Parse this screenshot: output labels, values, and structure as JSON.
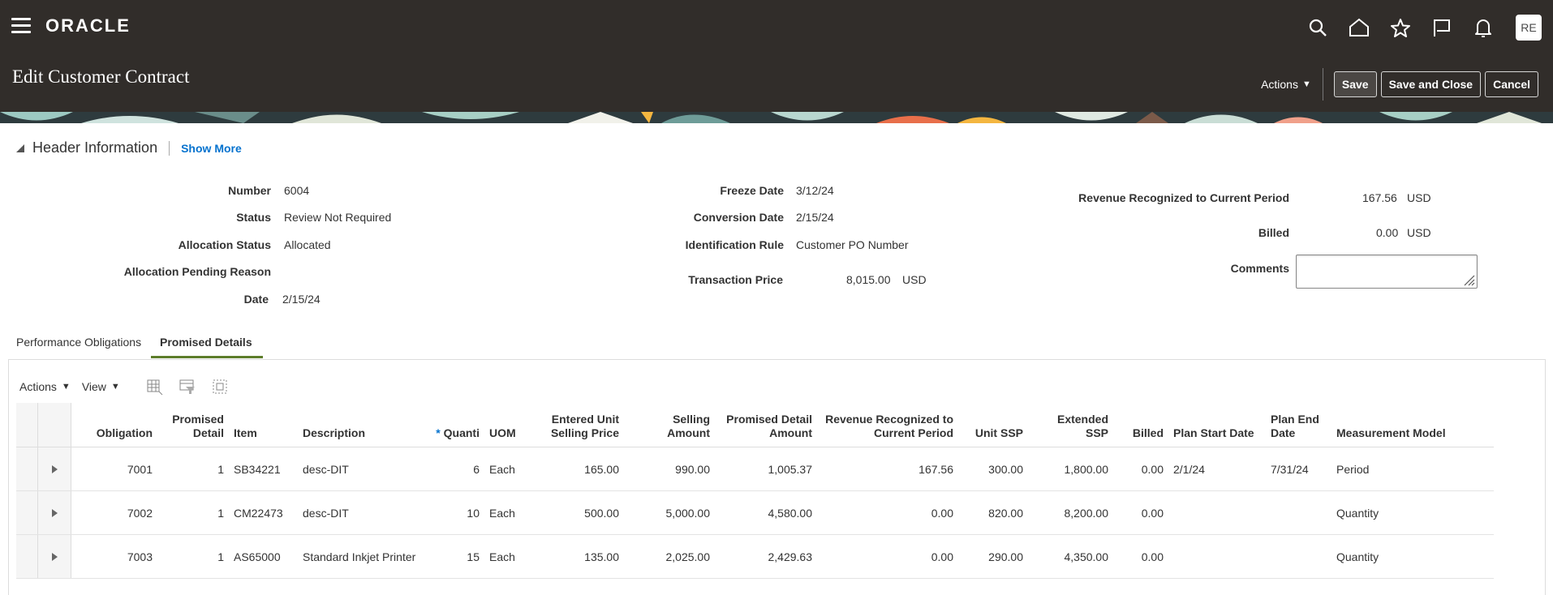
{
  "app": {
    "logo": "ORACLE",
    "avatar": "RE"
  },
  "icons": [
    "hamburger-icon",
    "search-icon",
    "home-icon",
    "star-icon",
    "flag-icon",
    "bell-icon"
  ],
  "page": {
    "title": "Edit Customer Contract",
    "actions_label": "Actions",
    "save_label": "Save",
    "save_close_label": "Save and Close",
    "cancel_label": "Cancel"
  },
  "header_section": {
    "title": "Header Information",
    "show_more": "Show More",
    "col1": [
      {
        "label": "Number",
        "value": "6004"
      },
      {
        "label": "Status",
        "value": "Review Not Required"
      },
      {
        "label": "Allocation Status",
        "value": "Allocated"
      },
      {
        "label": "Allocation Pending Reason",
        "value": ""
      },
      {
        "label": "Date",
        "value": "2/15/24"
      }
    ],
    "col2": [
      {
        "label": "Freeze Date",
        "value": "3/12/24"
      },
      {
        "label": "Conversion Date",
        "value": "2/15/24"
      },
      {
        "label": "Identification Rule",
        "value": "Customer PO Number"
      },
      {
        "label": "Transaction Price",
        "value": "8,015.00",
        "currency": "USD"
      }
    ],
    "col3": [
      {
        "label": "Revenue Recognized to Current Period",
        "value": "167.56",
        "currency": "USD"
      },
      {
        "label": "Billed",
        "value": "0.00",
        "currency": "USD"
      },
      {
        "label": "Comments",
        "value": ""
      }
    ]
  },
  "tabs": [
    {
      "label": "Performance Obligations",
      "active": false
    },
    {
      "label": "Promised Details",
      "active": true
    }
  ],
  "table_toolbar": {
    "actions_label": "Actions",
    "view_label": "View",
    "icons": [
      "freeze-columns-icon",
      "query-by-example-icon",
      "detach-icon"
    ]
  },
  "table": {
    "columns": [
      {
        "key": "obligation",
        "label": "Obligation"
      },
      {
        "key": "promised_detail",
        "label": "Promised Detail"
      },
      {
        "key": "item",
        "label": "Item"
      },
      {
        "key": "description",
        "label": "Description"
      },
      {
        "key": "quantity",
        "label": "Quanti",
        "required": true
      },
      {
        "key": "uom",
        "label": "UOM"
      },
      {
        "key": "entered_unit_selling_price",
        "label": "Entered Unit Selling Price"
      },
      {
        "key": "selling_amount",
        "label": "Selling Amount"
      },
      {
        "key": "promised_detail_amount",
        "label": "Promised Detail Amount"
      },
      {
        "key": "revenue_recognized",
        "label": "Revenue Recognized to Current Period"
      },
      {
        "key": "unit_ssp",
        "label": "Unit SSP"
      },
      {
        "key": "extended_ssp",
        "label": "Extended SSP"
      },
      {
        "key": "billed",
        "label": "Billed"
      },
      {
        "key": "plan_start_date",
        "label": "Plan Start Date"
      },
      {
        "key": "plan_end_date",
        "label": "Plan End Date"
      },
      {
        "key": "measurement_model",
        "label": "Measurement Model"
      }
    ],
    "rows": [
      {
        "obligation": "7001",
        "promised_detail": "1",
        "item": "SB34221",
        "description": "desc-DIT",
        "quantity": "6",
        "uom": "Each",
        "entered_unit_selling_price": "165.00",
        "selling_amount": "990.00",
        "promised_detail_amount": "1,005.37",
        "revenue_recognized": "167.56",
        "unit_ssp": "300.00",
        "extended_ssp": "1,800.00",
        "billed": "0.00",
        "plan_start_date": "2/1/24",
        "plan_end_date": "7/31/24",
        "measurement_model": "Period"
      },
      {
        "obligation": "7002",
        "promised_detail": "1",
        "item": "CM22473",
        "description": "desc-DIT",
        "quantity": "10",
        "uom": "Each",
        "entered_unit_selling_price": "500.00",
        "selling_amount": "5,000.00",
        "promised_detail_amount": "4,580.00",
        "revenue_recognized": "0.00",
        "unit_ssp": "820.00",
        "extended_ssp": "8,200.00",
        "billed": "0.00",
        "plan_start_date": "",
        "plan_end_date": "",
        "measurement_model": "Quantity"
      },
      {
        "obligation": "7003",
        "promised_detail": "1",
        "item": "AS65000",
        "description": "Standard Inkjet Printer",
        "quantity": "15",
        "uom": "Each",
        "entered_unit_selling_price": "135.00",
        "selling_amount": "2,025.00",
        "promised_detail_amount": "2,429.63",
        "revenue_recognized": "0.00",
        "unit_ssp": "290.00",
        "extended_ssp": "4,350.00",
        "billed": "0.00",
        "plan_start_date": "",
        "plan_end_date": "",
        "measurement_model": "Quantity"
      }
    ]
  }
}
